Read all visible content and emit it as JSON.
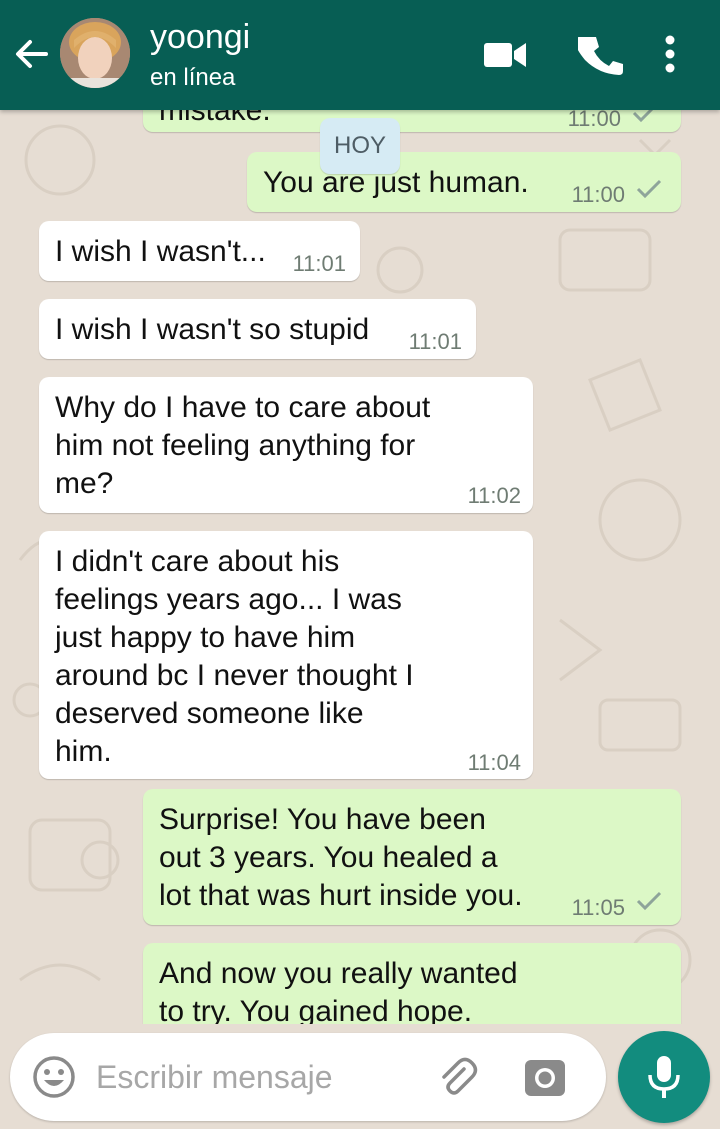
{
  "header": {
    "contact_name": "yoongi",
    "status": "en línea",
    "icons": [
      "back-arrow-icon",
      "video-call-icon",
      "phone-icon",
      "more-options-icon"
    ]
  },
  "messages": [
    {
      "direction": "out",
      "text": "mistake.",
      "time": "11:00",
      "ticks": "delivered"
    },
    {
      "direction": "out",
      "text": "You are just human.",
      "time": "11:00",
      "ticks": "delivered"
    },
    {
      "direction": "in",
      "text": "I wish I wasn't...",
      "time": "11:01"
    },
    {
      "direction": "in",
      "text": "I wish I wasn't so stupid",
      "time": "11:01"
    },
    {
      "direction": "in",
      "text": "Why do I have to care about\nhim not feeling anything for\nme?",
      "time": "11:02"
    },
    {
      "direction": "in",
      "text": "I didn't care about his\nfeelings years ago... I was\njust happy to have him\naround bc I never thought I\ndeserved someone like\nhim.",
      "time": "11:04"
    },
    {
      "direction": "out",
      "text": "Surprise! You have been\nout 3 years. You healed a\nlot that was hurt inside you.",
      "time": "11:05",
      "ticks": "delivered"
    },
    {
      "direction": "out",
      "text": "And now you really wanted\nto try. You gained hope.",
      "time": "",
      "ticks": ""
    }
  ],
  "day_divider": "HOY",
  "composer": {
    "placeholder": "Escribir mensaje",
    "icons": [
      "emoji-icon",
      "attach-icon",
      "camera-icon",
      "mic-icon"
    ]
  },
  "colors": {
    "header": "#075e54",
    "outgoing_bubble": "#dcf8c6",
    "incoming_bubble": "#ffffff",
    "mic_button": "#128c7e",
    "chat_background": "#e6ddd3"
  }
}
